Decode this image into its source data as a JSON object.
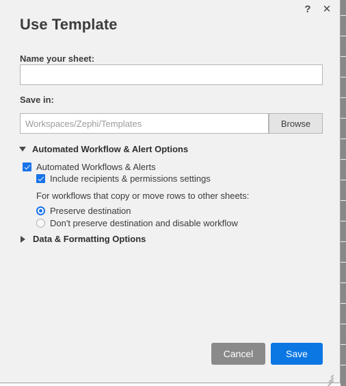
{
  "dialog": {
    "title": "Use Template",
    "help_icon": "question-mark-icon",
    "close_icon": "close-icon"
  },
  "name_field": {
    "label": "Name your sheet:",
    "value": "",
    "placeholder": ""
  },
  "save_in": {
    "label": "Save in:",
    "value": "",
    "placeholder": "Workspaces/Zephi/Templates",
    "browse_label": "Browse"
  },
  "workflow_section": {
    "title": "Automated Workflow & Alert Options",
    "expanded": true,
    "highlighted": true,
    "highlight_color": "#fdf21a",
    "options": {
      "automated_workflows": {
        "label": "Automated Workflows & Alerts",
        "checked": true
      },
      "include_recipients": {
        "label": "Include recipients & permissions settings",
        "checked": true
      },
      "note": "For workflows that copy or move rows to other sheets:",
      "radios": [
        {
          "label": "Preserve destination",
          "selected": true
        },
        {
          "label": "Don't preserve destination and disable workflow",
          "selected": false
        }
      ]
    }
  },
  "data_section": {
    "title": "Data & Formatting Options",
    "expanded": false
  },
  "footer": {
    "cancel_label": "Cancel",
    "save_label": "Save",
    "cancel_color": "#8a8a8a",
    "save_color": "#0b77e3"
  }
}
